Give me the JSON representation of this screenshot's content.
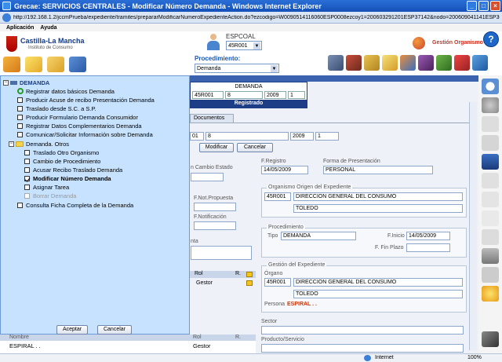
{
  "window": {
    "title": "Grecae: SERVICIOS CENTRALES - Modificar Número Demanda - Windows Internet Explorer",
    "url": "http://192.168.1.2/jccmPrueba/expediente/tramites/prepararModificarNumeroExpedienteAction.do?ezcodigo=W0090514116060ESP0008ezcoy1=200603291201ESP37142&nodo=200609041141ESP3095"
  },
  "menu": {
    "items": [
      "Aplicación",
      "Ayuda"
    ]
  },
  "header": {
    "logo_name": "Castilla-La Mancha",
    "logo_sub": "Instituto de Consumo",
    "espcoal_label": "ESPCOAL",
    "espcoal_value": "45R001",
    "gestion_label": "Gestión Organismo",
    "help_icon": "?",
    "procedimiento_label": "Procedimiento:",
    "procedimiento_value": "Demanda"
  },
  "demanda_box": {
    "title": "DEMANDA",
    "cells": [
      "45R001",
      "8",
      "2009",
      "1"
    ],
    "status": "Registrado"
  },
  "tree": {
    "root": "DEMANDA",
    "items": [
      {
        "label": "Registrar datos básicos Demanda",
        "type": "done"
      },
      {
        "label": "Producir Acuse de recibo Presentación Demanda",
        "type": "cb"
      },
      {
        "label": "Traslado desde S.C. a S.P.",
        "type": "cb"
      },
      {
        "label": "Producir Formulario Demanda Consumidor",
        "type": "cb"
      },
      {
        "label": "Registrar Datos Complementarios Demanda",
        "type": "cb"
      },
      {
        "label": "Comunicar/Solicitar Información sobre Demanda",
        "type": "cb"
      }
    ],
    "subfolder": "Demanda. Otros",
    "subitems": [
      {
        "label": "Traslado Otro Organismo",
        "state": "unchecked"
      },
      {
        "label": "Cambio de Procedimiento",
        "state": "unchecked"
      },
      {
        "label": "Acusar Recibo Traslado Demanda",
        "state": "unchecked"
      },
      {
        "label": "Modificar Número Demanda",
        "state": "checked"
      },
      {
        "label": "Asignar Tarea",
        "state": "unchecked"
      },
      {
        "label": "Borrar Demanda",
        "state": "disabled"
      }
    ],
    "last_item": "Consulta Ficha Completa de la Demanda",
    "accept_label": "Aceptar",
    "cancel_label": "Cancelar"
  },
  "form": {
    "tab_documentos": "Documentos",
    "num_fields": [
      "01",
      "8",
      "2009",
      "1"
    ],
    "modify_label": "Modificar",
    "cancel_label": "Cancelar",
    "cambio_estado_label": "n Cambio Estado",
    "fregistro_label": "F.Registro",
    "fregistro_value": "14/05/2009",
    "forma_label": "Forma de Presentación",
    "forma_value": "PERSONAL",
    "organismo_origen_title": "Organismo Origen del Expediente",
    "origen_code": "45R001",
    "origen_name": "DIRECCION GENERAL DEL CONSUMO",
    "origen_city": "TOLEDO",
    "fnot_label": "F.Not.Propuesta",
    "fnotif_label": "F.Notificación",
    "nta_label": "nta",
    "procedimiento_title": "Procedimiento",
    "tipo_label": "Tipo",
    "tipo_value": "DEMANDA",
    "finicio_label": "F.Inicio",
    "finicio_value": "14/05/2009",
    "ffin_label": "F. Fin Plazo",
    "gestion_title": "Gestión del Expediente",
    "organo_label": "Órgano",
    "organo_code": "45R001",
    "organo_name": "DIRECCION GENERAL DEL CONSUMO",
    "organo_city": "TOLEDO",
    "persona_label": "Persona",
    "persona_value": "ESPIRAL . .",
    "rol_header": "Rol",
    "r_header": "R.",
    "rol_value": "Gestor",
    "sector_label": "Sector",
    "producto_label": "Producto/Servicio",
    "nombre_header": "Nombre",
    "bottom_name": "ESPIRAL . .",
    "bottom_rol": "Gestor"
  },
  "status": {
    "zone": "Internet",
    "zoom": "100%"
  }
}
